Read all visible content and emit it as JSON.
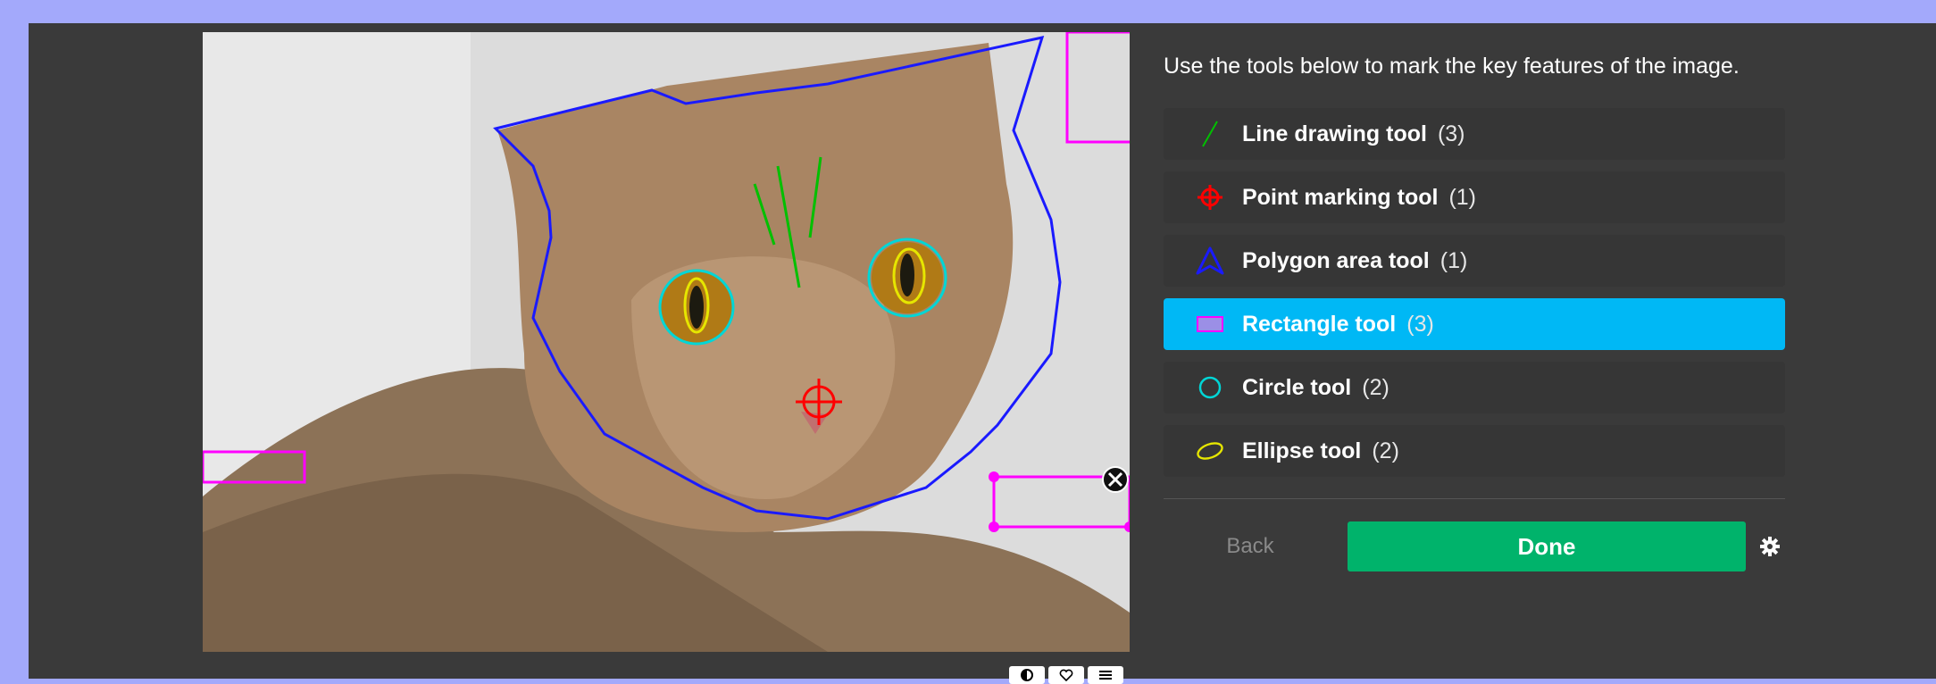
{
  "task": {
    "instruction": "Use the tools below to mark the key features of the image."
  },
  "tools": [
    {
      "label": "Line drawing tool",
      "count": "(3)",
      "icon": "line-icon",
      "color": "#00c000"
    },
    {
      "label": "Point marking tool",
      "count": "(1)",
      "icon": "crosshair-icon",
      "color": "#ff0000"
    },
    {
      "label": "Polygon area tool",
      "count": "(1)",
      "icon": "polygon-icon",
      "color": "#1a1aff"
    },
    {
      "label": "Rectangle tool",
      "count": "(3)",
      "icon": "rectangle-icon",
      "color": "#ff00ff",
      "active": true
    },
    {
      "label": "Circle tool",
      "count": "(2)",
      "icon": "circle-icon",
      "color": "#00d6d6"
    },
    {
      "label": "Ellipse tool",
      "count": "(2)",
      "icon": "ellipse-icon",
      "color": "#e6e600"
    }
  ],
  "buttons": {
    "back": "Back",
    "done": "Done"
  },
  "colors": {
    "page_bg": "#a3a9fb",
    "panel_bg": "#3a3a3a",
    "active_tool": "#00b8f5",
    "done_button": "#00b36b"
  },
  "subject": {
    "image_icon": "cat-photo"
  }
}
